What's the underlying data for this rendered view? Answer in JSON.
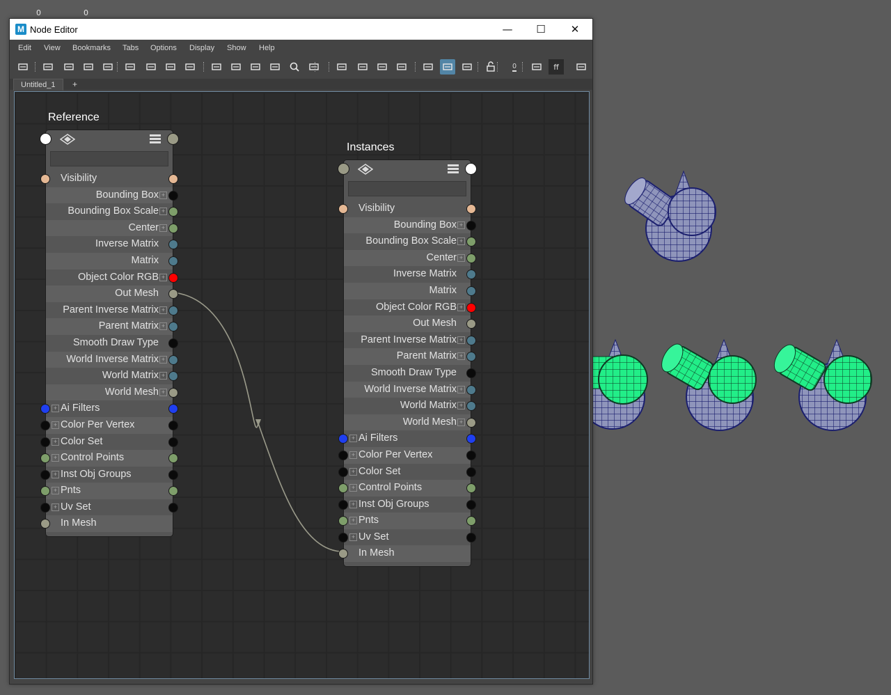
{
  "top_numbers": [
    "0",
    "0"
  ],
  "window": {
    "title": "Node Editor",
    "logo": "M",
    "controls": {
      "minimize": "—",
      "maximize": "☐",
      "close": "✕"
    }
  },
  "menu": [
    "Edit",
    "View",
    "Bookmarks",
    "Tabs",
    "Options",
    "Display",
    "Show",
    "Help"
  ],
  "toolbar_icons": [
    "add-node-icon",
    "swap-icon",
    "input-connections-icon",
    "io-connections-icon",
    "output-connections-icon",
    "frame-all-icon",
    "layout-horizontal-icon",
    "layout-vertical-icon",
    "distribute-icon",
    "attr-simple-icon",
    "attr-connected-icon",
    "attr-custom-icon",
    "attr-all-icon",
    "search-icon",
    "snapshot-icon",
    "bookmark-add-icon",
    "bookmark-edit-icon",
    "bookmark-prev-icon",
    "bookmark-next-icon",
    "graph-input-icon",
    "graph-both-icon",
    "graph-output-icon",
    "lock-icon",
    "pin-icon",
    "align-icon",
    "ff-icon",
    "expand-icon"
  ],
  "toolbar_labels": {
    "zero": "0",
    "ff": "ff"
  },
  "tabs": {
    "active": "Untitled_1",
    "add": "+"
  },
  "colors": {
    "port_tan": "#e5b894",
    "port_black": "#0a0a0a",
    "port_green": "#7e9e6a",
    "port_teal": "#4e7a8c",
    "port_red": "#ff0000",
    "port_grey": "#9a9a86",
    "port_blue": "#1f3ff0",
    "port_white": "#ffffff",
    "mesh_green": "#22ee88",
    "mesh_wire": "#1b1f6e"
  },
  "nodes": {
    "reference": {
      "title": "Reference",
      "attributes": [
        {
          "label": "Visibility",
          "align": "left",
          "in": "tan",
          "out": "tan",
          "plus": false
        },
        {
          "label": "Bounding Box",
          "align": "right",
          "in": null,
          "out": "black",
          "plus": true
        },
        {
          "label": "Bounding Box Scale",
          "align": "right",
          "in": null,
          "out": "green",
          "plus": true
        },
        {
          "label": "Center",
          "align": "right",
          "in": null,
          "out": "green",
          "plus": true
        },
        {
          "label": "Inverse Matrix",
          "align": "right",
          "in": null,
          "out": "teal",
          "plus": false
        },
        {
          "label": "Matrix",
          "align": "right",
          "in": null,
          "out": "teal",
          "plus": false
        },
        {
          "label": "Object Color RGB",
          "align": "right",
          "in": null,
          "out": "red",
          "plus": true
        },
        {
          "label": "Out Mesh",
          "align": "right",
          "in": null,
          "out": "grey",
          "plus": false
        },
        {
          "label": "Parent Inverse Matrix",
          "align": "right",
          "in": null,
          "out": "teal",
          "plus": true
        },
        {
          "label": "Parent Matrix",
          "align": "right",
          "in": null,
          "out": "teal",
          "plus": true
        },
        {
          "label": "Smooth Draw Type",
          "align": "right",
          "in": null,
          "out": "black",
          "plus": false
        },
        {
          "label": "World Inverse Matrix",
          "align": "right",
          "in": null,
          "out": "teal",
          "plus": true
        },
        {
          "label": "World Matrix",
          "align": "right",
          "in": null,
          "out": "teal",
          "plus": true
        },
        {
          "label": "World Mesh",
          "align": "right",
          "in": null,
          "out": "grey",
          "plus": true
        },
        {
          "label": "Ai Filters",
          "align": "left",
          "in": "blue",
          "out": "blue",
          "plus": true
        },
        {
          "label": "Color Per Vertex",
          "align": "left",
          "in": "black",
          "out": "black",
          "plus": true
        },
        {
          "label": "Color Set",
          "align": "left",
          "in": "black",
          "out": "black",
          "plus": true
        },
        {
          "label": "Control Points",
          "align": "left",
          "in": "green",
          "out": "green",
          "plus": true
        },
        {
          "label": "Inst Obj Groups",
          "align": "left",
          "in": "black",
          "out": "black",
          "plus": true
        },
        {
          "label": "Pnts",
          "align": "left",
          "in": "green",
          "out": "green",
          "plus": true
        },
        {
          "label": "Uv Set",
          "align": "left",
          "in": "black",
          "out": "black",
          "plus": true
        },
        {
          "label": "In Mesh",
          "align": "left",
          "in": "grey",
          "out": null,
          "plus": false
        }
      ]
    },
    "instances": {
      "title": "Instances",
      "attributes": [
        {
          "label": "Visibility",
          "align": "left",
          "in": "tan",
          "out": "tan",
          "plus": false
        },
        {
          "label": "Bounding Box",
          "align": "right",
          "in": null,
          "out": "black",
          "plus": true
        },
        {
          "label": "Bounding Box Scale",
          "align": "right",
          "in": null,
          "out": "green",
          "plus": true
        },
        {
          "label": "Center",
          "align": "right",
          "in": null,
          "out": "green",
          "plus": true
        },
        {
          "label": "Inverse Matrix",
          "align": "right",
          "in": null,
          "out": "teal",
          "plus": false
        },
        {
          "label": "Matrix",
          "align": "right",
          "in": null,
          "out": "teal",
          "plus": false
        },
        {
          "label": "Object Color RGB",
          "align": "right",
          "in": null,
          "out": "red",
          "plus": true
        },
        {
          "label": "Out Mesh",
          "align": "right",
          "in": null,
          "out": "grey",
          "plus": false
        },
        {
          "label": "Parent Inverse Matrix",
          "align": "right",
          "in": null,
          "out": "teal",
          "plus": true
        },
        {
          "label": "Parent Matrix",
          "align": "right",
          "in": null,
          "out": "teal",
          "plus": true
        },
        {
          "label": "Smooth Draw Type",
          "align": "right",
          "in": null,
          "out": "black",
          "plus": false
        },
        {
          "label": "World Inverse Matrix",
          "align": "right",
          "in": null,
          "out": "teal",
          "plus": true
        },
        {
          "label": "World Matrix",
          "align": "right",
          "in": null,
          "out": "teal",
          "plus": true
        },
        {
          "label": "World Mesh",
          "align": "right",
          "in": null,
          "out": "grey",
          "plus": true
        },
        {
          "label": "Ai Filters",
          "align": "left",
          "in": "blue",
          "out": "blue",
          "plus": true
        },
        {
          "label": "Color Per Vertex",
          "align": "left",
          "in": "black",
          "out": "black",
          "plus": true
        },
        {
          "label": "Color Set",
          "align": "left",
          "in": "black",
          "out": "black",
          "plus": true
        },
        {
          "label": "Control Points",
          "align": "left",
          "in": "green",
          "out": "green",
          "plus": true
        },
        {
          "label": "Inst Obj Groups",
          "align": "left",
          "in": "black",
          "out": "black",
          "plus": true
        },
        {
          "label": "Pnts",
          "align": "left",
          "in": "green",
          "out": "green",
          "plus": true
        },
        {
          "label": "Uv Set",
          "align": "left",
          "in": "black",
          "out": "black",
          "plus": true
        },
        {
          "label": "In Mesh",
          "align": "left",
          "in": "grey",
          "out": null,
          "plus": false
        }
      ]
    }
  }
}
